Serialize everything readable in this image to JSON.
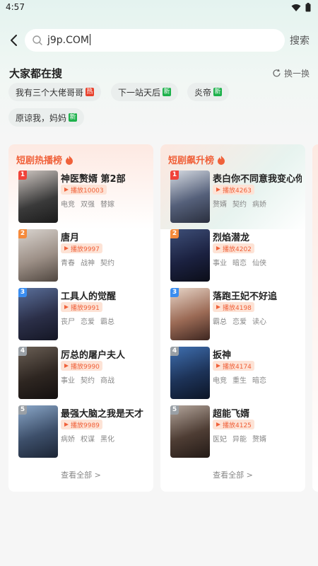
{
  "status": {
    "time": "4:57"
  },
  "search": {
    "value": "j9p.COM",
    "button": "搜索"
  },
  "hot_searches": {
    "title": "大家都在搜",
    "refresh_label": "换一换",
    "chips": [
      {
        "text": "我有三个大佬哥哥",
        "badge": "热",
        "badge_color": "#e8412c"
      },
      {
        "text": "下一站天后",
        "badge": "新",
        "badge_color": "#1db14b"
      },
      {
        "text": "炎帝",
        "badge": "新",
        "badge_color": "#1db14b"
      },
      {
        "text": "原谅我，妈妈",
        "badge": "新",
        "badge_color": "#1db14b"
      }
    ]
  },
  "rankings": [
    {
      "title": "短剧热播榜",
      "see_all": "查看全部 >",
      "items": [
        {
          "rank": "1",
          "title": "神医赘婿 第2部",
          "plays": "播放10003",
          "tags": [
            "电竞",
            "双强",
            "替嫁"
          ]
        },
        {
          "rank": "2",
          "title": "唐月",
          "plays": "播放9997",
          "tags": [
            "青春",
            "战神",
            "契约"
          ]
        },
        {
          "rank": "3",
          "title": "工具人的觉醒",
          "plays": "播放9991",
          "tags": [
            "丧尸",
            "恋爱",
            "霸总"
          ]
        },
        {
          "rank": "4",
          "title": "厉总的屠户夫人",
          "plays": "播放9990",
          "tags": [
            "事业",
            "契约",
            "商战"
          ]
        },
        {
          "rank": "5",
          "title": "最强大脑之我是天才",
          "plays": "播放9989",
          "tags": [
            "病娇",
            "权谋",
            "黑化"
          ]
        }
      ]
    },
    {
      "title": "短剧飙升榜",
      "see_all": "查看全部 >",
      "items": [
        {
          "rank": "1",
          "title": "表白你不同意我变心你么",
          "plays": "播放4263",
          "tags": [
            "赘婿",
            "契约",
            "病娇"
          ]
        },
        {
          "rank": "2",
          "title": "烈焰潜龙",
          "plays": "播放4202",
          "tags": [
            "事业",
            "暗恋",
            "仙侠"
          ]
        },
        {
          "rank": "3",
          "title": "落跑王妃不好追",
          "plays": "播放4198",
          "tags": [
            "霸总",
            "恋爱",
            "读心"
          ]
        },
        {
          "rank": "4",
          "title": "扳神",
          "plays": "播放4174",
          "tags": [
            "电竞",
            "重生",
            "暗恋"
          ]
        },
        {
          "rank": "5",
          "title": "超能飞婿",
          "plays": "播放4125",
          "tags": [
            "医妃",
            "异能",
            "赘婿"
          ]
        }
      ]
    }
  ],
  "colors": {
    "accent": "#f0613a",
    "rank_colors": [
      "#f0433a",
      "#f58a3b",
      "#3a8df0",
      "#9aa0a6",
      "#9aa0a6"
    ]
  }
}
